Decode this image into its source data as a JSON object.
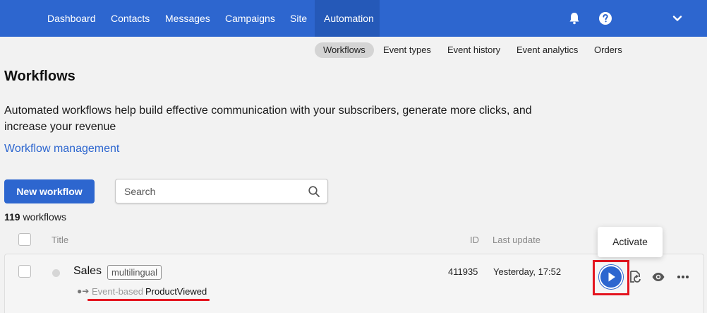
{
  "nav": {
    "items": [
      {
        "label": "Dashboard"
      },
      {
        "label": "Contacts"
      },
      {
        "label": "Messages"
      },
      {
        "label": "Campaigns"
      },
      {
        "label": "Site"
      },
      {
        "label": "Automation"
      }
    ],
    "active": "Automation",
    "icons": [
      "bell-icon",
      "help-icon",
      "chevron-down-icon"
    ]
  },
  "subtabs": {
    "items": [
      {
        "label": "Workflows"
      },
      {
        "label": "Event types"
      },
      {
        "label": "Event history"
      },
      {
        "label": "Event analytics"
      },
      {
        "label": "Orders"
      }
    ],
    "active": "Workflows"
  },
  "page": {
    "title": "Workflows",
    "description": "Automated workflows help build effective communication with your subscribers, generate more clicks, and increase your revenue",
    "link": "Workflow management"
  },
  "toolbar": {
    "new_button": "New workflow",
    "search_placeholder": "Search"
  },
  "summary": {
    "count": "119",
    "count_label": "workflows"
  },
  "table": {
    "columns": {
      "title": "Title",
      "id": "ID",
      "last_update": "Last update"
    },
    "rows": [
      {
        "title": "Sales",
        "tag": "multilingual",
        "trigger_type": "Event-based",
        "trigger_event": "ProductViewed",
        "id": "411935",
        "last_update": "Yesterday, 17:52",
        "actions": [
          "play-icon",
          "duplicate-icon",
          "eye-icon",
          "more-icon"
        ]
      }
    ]
  },
  "tooltip": {
    "text": "Activate"
  },
  "colors": {
    "accent": "#2d66cf",
    "highlight": "#e4151f",
    "background": "#f2f2f2"
  }
}
